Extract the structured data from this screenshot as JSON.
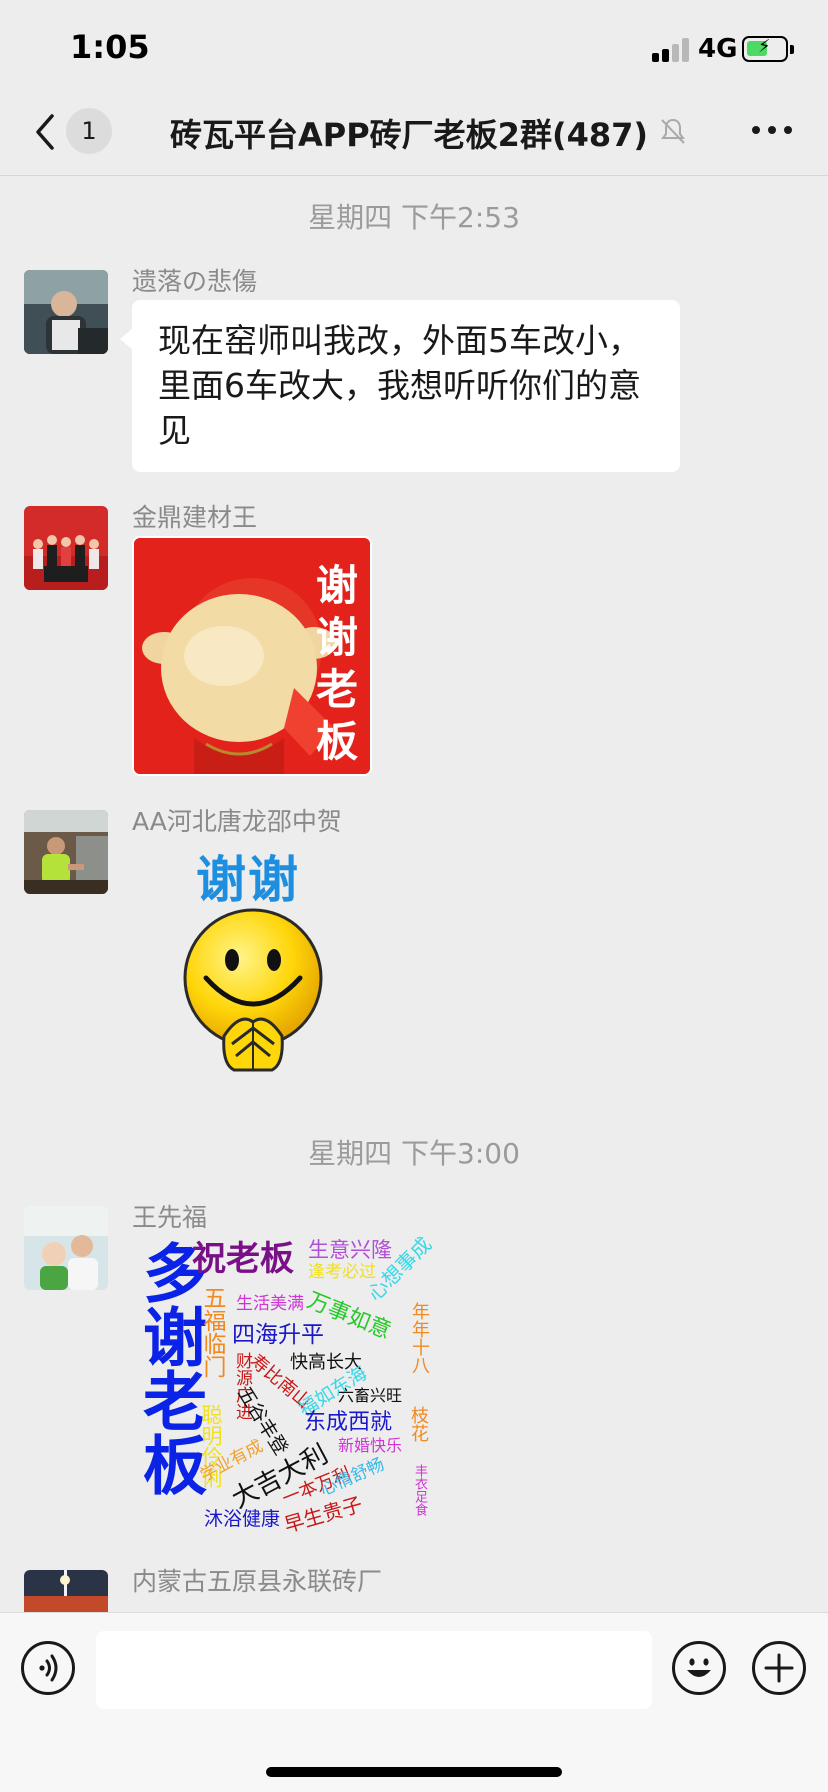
{
  "status_bar": {
    "time": "1:05",
    "network": "4G"
  },
  "nav": {
    "unread_count": "1",
    "title": "砖瓦平台APP砖厂老板2群(487)",
    "icons": [
      "back-icon",
      "mute-icon",
      "more-icon"
    ]
  },
  "timestamps": [
    "星期四 下午2:53",
    "星期四 下午3:00"
  ],
  "messages": [
    {
      "sender": "遗落の悲傷",
      "type": "text",
      "text": "现在窑师叫我改，外面5车改小，里面6车改大，我想听听你们的意见"
    },
    {
      "sender": "金鼎建材王",
      "type": "sticker",
      "sticker_text": "谢谢老板"
    },
    {
      "sender": "AA河北唐龙邵中贺",
      "type": "sticker",
      "sticker_text": "谢谢"
    },
    {
      "sender": "王先福",
      "type": "sticker"
    },
    {
      "sender": "内蒙古五原县永联砖厂",
      "type": "partial"
    }
  ],
  "word_cloud": {
    "words": [
      "多谢老板",
      "祝老板",
      "生意兴隆",
      "逢考必过",
      "心想事成",
      "五福临门",
      "生活美满",
      "万事如意",
      "年年十八",
      "四海升平",
      "聪明伶俐",
      "财源广进",
      "寿比南山",
      "快高长大",
      "福如东海",
      "五谷丰登",
      "六畜兴旺",
      "东成西就",
      "枝花",
      "学业有成",
      "大吉大利",
      "新婚快乐",
      "一本万利",
      "心情舒畅",
      "丰衣足食",
      "沐浴健康",
      "早生贵子"
    ]
  },
  "input_bar": {
    "icons": [
      "voice-icon",
      "emoji-icon",
      "plus-icon"
    ],
    "placeholder": ""
  }
}
